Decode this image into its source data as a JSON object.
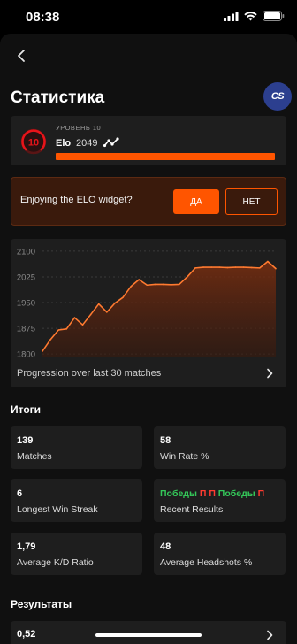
{
  "status_bar": {
    "time": "08:38"
  },
  "header": {
    "title": "Статистика",
    "avatar_text": "CS"
  },
  "elo_card": {
    "level_label": "УРОВЕНЬ 10",
    "level_number": "10",
    "elo_label": "Elo",
    "elo_value": "2049",
    "progress": 1.0,
    "accent_color": "#ff5500"
  },
  "widget_banner": {
    "question": "Enjoying the ELO widget?",
    "yes_label": "ДА",
    "no_label": "НЕТ"
  },
  "chart": {
    "caption": "Progression over last 30 matches"
  },
  "chart_data": {
    "type": "area",
    "title": "",
    "xlabel": "",
    "ylabel": "",
    "ylim": [
      1790,
      2110
    ],
    "y_ticks": [
      "2100",
      "2025",
      "1950",
      "1875",
      "1800"
    ],
    "y_tick_values": [
      2100,
      2025,
      1950,
      1875,
      1800
    ],
    "grid": true,
    "color": "#ff7a30",
    "x": [
      1,
      2,
      3,
      4,
      5,
      6,
      7,
      8,
      9,
      10,
      11,
      12,
      13,
      14,
      15,
      16,
      17,
      18,
      19,
      20,
      21,
      22,
      23,
      24,
      25,
      26,
      27,
      28,
      29,
      30
    ],
    "values": [
      1808,
      1842,
      1870,
      1873,
      1906,
      1885,
      1915,
      1946,
      1922,
      1948,
      1965,
      1997,
      2017,
      2001,
      2003,
      2003,
      2002,
      2003,
      2025,
      2051,
      2053,
      2053,
      2053,
      2052,
      2053,
      2053,
      2052,
      2051,
      2070,
      2049
    ]
  },
  "totals": {
    "title": "Итоги",
    "matches": {
      "value": "139",
      "label": "Matches"
    },
    "win_rate": {
      "value": "58",
      "label": "Win Rate %"
    },
    "win_streak": {
      "value": "6",
      "label": "Longest Win Streak"
    },
    "recent": {
      "label": "Recent Results",
      "items": [
        {
          "text": "Победы",
          "type": "win"
        },
        {
          "text": "П",
          "type": "loss"
        },
        {
          "text": "П",
          "type": "loss"
        },
        {
          "text": "Победы",
          "type": "win"
        },
        {
          "text": "П",
          "type": "loss"
        }
      ]
    },
    "kd": {
      "value": "1,79",
      "label": "Average K/D Ratio"
    },
    "headshots": {
      "value": "48",
      "label": "Average Headshots %"
    }
  },
  "results": {
    "title": "Результаты",
    "first_value": "0,52"
  },
  "colors": {
    "accent": "#ff5500",
    "win": "#34c759",
    "loss": "#ff3b30",
    "card": "#1e1e1e"
  }
}
